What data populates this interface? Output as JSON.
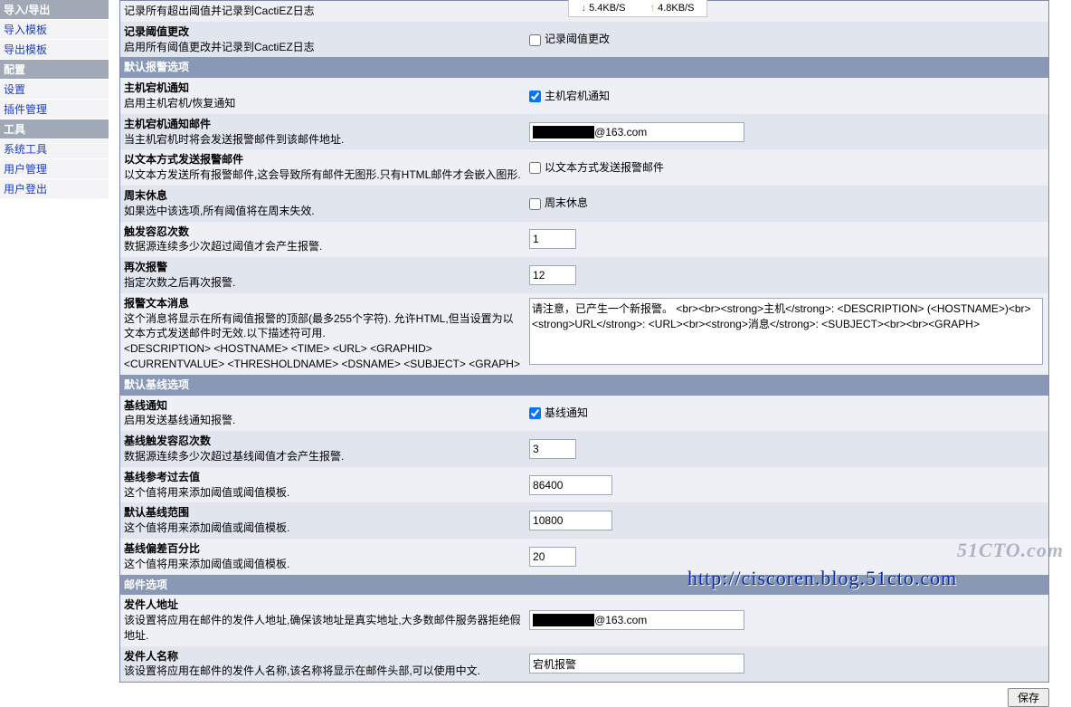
{
  "sidebar": {
    "h1": "导入/导出",
    "i1": "导入模板",
    "i2": "导出模板",
    "h2": "配置",
    "i3": "设置",
    "i4": "插件管理",
    "h3": "工具",
    "i5": "系统工具",
    "i6": "用户管理",
    "i7": "用户登出"
  },
  "net": {
    "down": "5.4KB/S",
    "up": "4.8KB/S"
  },
  "rows": {
    "r0": {
      "t": "",
      "d": "记录所有超出阈值并记录到CactiEZ日志"
    },
    "r1": {
      "t": "记录阈值更改",
      "d": "启用所有阈值更改并记录到CactiEZ日志",
      "chk": "记录阈值更改"
    },
    "sec1": "默认报警选项",
    "r2": {
      "t": "主机宕机通知",
      "d": "启用主机宕机/恢复通知",
      "chk": "主机宕机通知"
    },
    "r3": {
      "t": "主机宕机通知邮件",
      "d": "当主机宕机时将会发送报警邮件到该邮件地址.",
      "val": "████████@163.com"
    },
    "r4": {
      "t": "以文本方式发送报警邮件",
      "d": "以文本方发送所有报警邮件,这会导致所有邮件无图形.只有HTML邮件才会嵌入图形.",
      "chk": "以文本方式发送报警邮件"
    },
    "r5": {
      "t": "周末休息",
      "d": "如果选中该选项,所有阈值将在周末失效.",
      "chk": "周末休息"
    },
    "r6": {
      "t": "触发容忍次数",
      "d": "数据源连续多少次超过阈值才会产生报警.",
      "val": "1"
    },
    "r7": {
      "t": "再次报警",
      "d": "指定次数之后再次报警.",
      "val": "12"
    },
    "r8": {
      "t": "报警文本消息",
      "d": "这个消息将显示在所有阈值报警的顶部(最多255个字符). 允许HTML,但当设置为以文本方式发送邮件时无效.以下描述符可用.\n<DESCRIPTION> <HOSTNAME> <TIME> <URL> <GRAPHID> <CURRENTVALUE> <THRESHOLDNAME> <DSNAME> <SUBJECT> <GRAPH>",
      "val": "请注意，已产生一个新报警。 <br><br><strong>主机</strong>: <DESCRIPTION> (<HOSTNAME>)<br><strong>URL</strong>: <URL><br><strong>消息</strong>: <SUBJECT><br><br><GRAPH>"
    },
    "sec2": "默认基线选项",
    "r9": {
      "t": "基线通知",
      "d": "启用发送基线通知报警.",
      "chk": "基线通知"
    },
    "r10": {
      "t": "基线触发容忍次数",
      "d": "数据源连续多少次超过基线阈值才会产生报警.",
      "val": "3"
    },
    "r11": {
      "t": "基线参考过去值",
      "d": "这个值将用来添加阈值或阈值模板.",
      "val": "86400"
    },
    "r12": {
      "t": "默认基线范围",
      "d": "这个值将用来添加阈值或阈值模板.",
      "val": "10800"
    },
    "r13": {
      "t": "基线偏差百分比",
      "d": "这个值将用来添加阈值或阈值模板.",
      "val": "20"
    },
    "sec3": "邮件选项",
    "r14": {
      "t": "发件人地址",
      "d": "该设置将应用在邮件的发件人地址,确保该地址是真实地址,大多数邮件服务器拒绝假地址.",
      "val": "████████@163.com"
    },
    "r15": {
      "t": "发件人名称",
      "d": "该设置将应用在邮件的发件人名称,该名称将显示在邮件头部,可以使用中文.",
      "val": "宕机报警"
    }
  },
  "save": "保存",
  "footer": {
    "wm": "51CTO.com",
    "url": "http://ciscoren.blog.51cto.com"
  }
}
